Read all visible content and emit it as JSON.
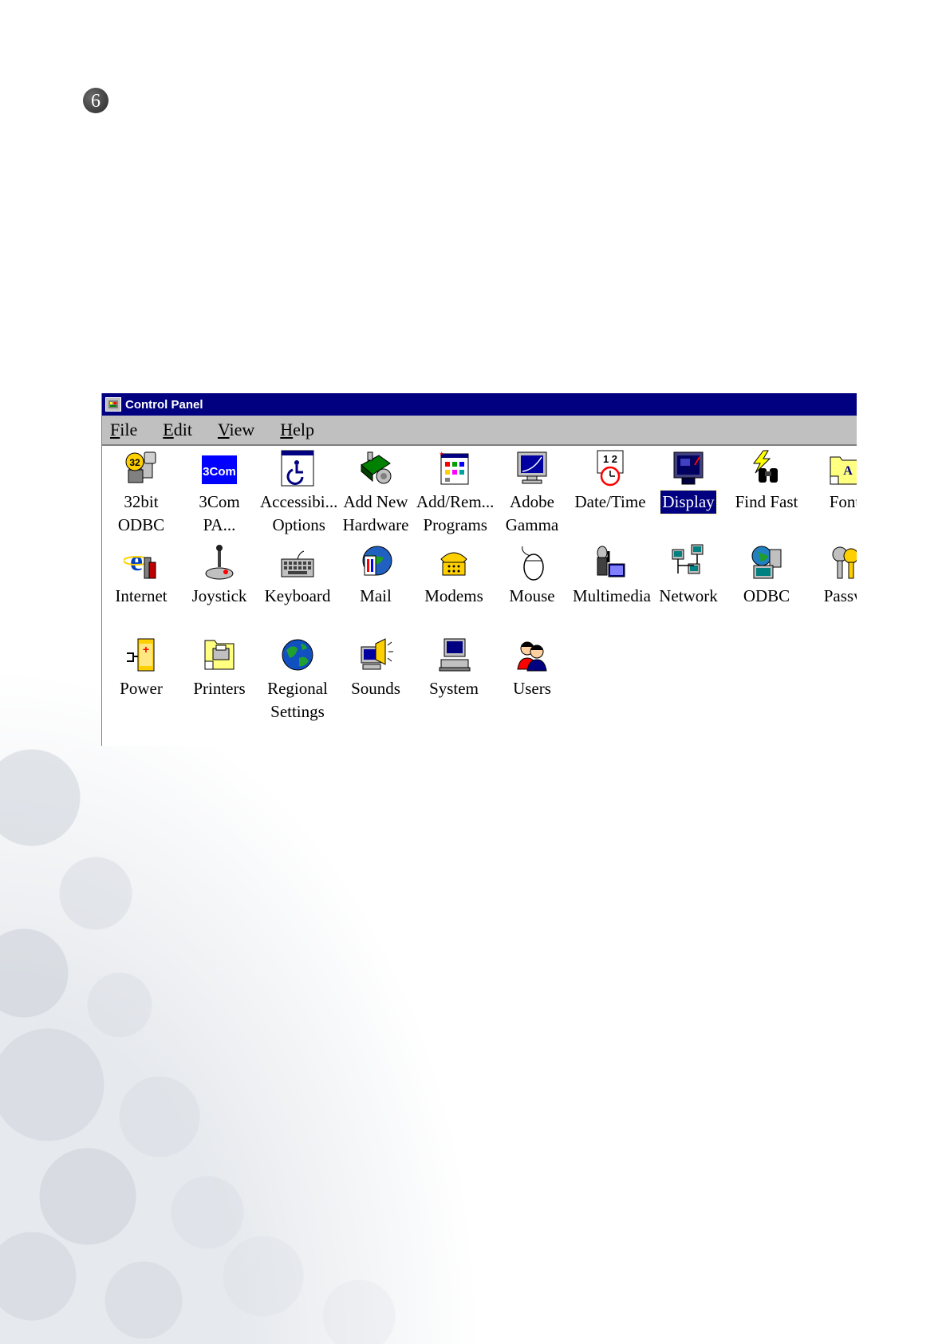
{
  "step": {
    "number": "6"
  },
  "window": {
    "title": "Control Panel",
    "menu": [
      {
        "first": "F",
        "rest": "ile"
      },
      {
        "first": "E",
        "rest": "dit"
      },
      {
        "first": "V",
        "rest": "iew"
      },
      {
        "first": "H",
        "rest": "elp"
      }
    ],
    "items": [
      {
        "label": "32bit\nODBC",
        "icon": "odbc32-icon"
      },
      {
        "label": "3Com\nPA...",
        "icon": "3com-icon",
        "badge": "3Com"
      },
      {
        "label": "Accessibi...\nOptions",
        "icon": "accessibility-icon"
      },
      {
        "label": "Add New\nHardware",
        "icon": "add-hardware-icon"
      },
      {
        "label": "Add/Rem...\nPrograms",
        "icon": "add-remove-programs-icon"
      },
      {
        "label": "Adobe\nGamma",
        "icon": "adobe-gamma-icon"
      },
      {
        "label": "Date/Time",
        "icon": "date-time-icon"
      },
      {
        "label": "Display",
        "icon": "display-icon",
        "selected": true
      },
      {
        "label": "Find Fast",
        "icon": "find-fast-icon"
      },
      {
        "label": "Font",
        "icon": "fonts-icon"
      },
      {
        "label": "Internet",
        "icon": "internet-icon"
      },
      {
        "label": "Joystick",
        "icon": "joystick-icon"
      },
      {
        "label": "Keyboard",
        "icon": "keyboard-icon"
      },
      {
        "label": "Mail",
        "icon": "mail-icon"
      },
      {
        "label": "Modems",
        "icon": "modems-icon"
      },
      {
        "label": "Mouse",
        "icon": "mouse-icon"
      },
      {
        "label": "Multimedia",
        "icon": "multimedia-icon"
      },
      {
        "label": "Network",
        "icon": "network-icon"
      },
      {
        "label": "ODBC",
        "icon": "odbc-icon"
      },
      {
        "label": "Passw",
        "icon": "passwords-icon"
      },
      {
        "label": "Power",
        "icon": "power-icon"
      },
      {
        "label": "Printers",
        "icon": "printers-icon"
      },
      {
        "label": "Regional\nSettings",
        "icon": "regional-settings-icon"
      },
      {
        "label": "Sounds",
        "icon": "sounds-icon"
      },
      {
        "label": "System",
        "icon": "system-icon"
      },
      {
        "label": "Users",
        "icon": "users-icon"
      }
    ]
  },
  "colors": {
    "titlebar": "#000080",
    "menubar": "#c0c0c0",
    "selection": "#000080"
  }
}
